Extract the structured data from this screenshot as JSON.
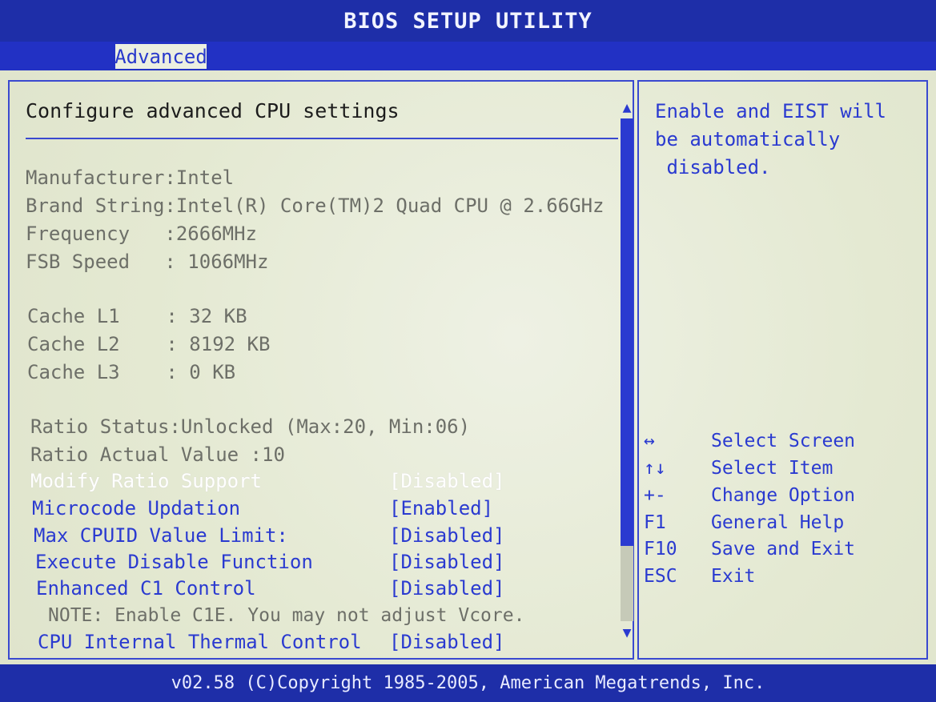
{
  "title": "BIOS SETUP UTILITY",
  "tabs": [
    {
      "label": "Advanced",
      "active": true
    }
  ],
  "section_title": "Configure advanced CPU settings",
  "cpu_info": [
    {
      "label": "Manufacturer",
      "value": ":Intel"
    },
    {
      "label": "Brand String",
      "value": ":Intel(R) Core(TM)2 Quad CPU @ 2.66GHz"
    },
    {
      "label": "Frequency   ",
      "value": ":2666MHz"
    },
    {
      "label": "FSB Speed   ",
      "value": ": 1066MHz"
    }
  ],
  "cache_info": [
    {
      "label": "Cache L1    ",
      "value": ": 32 KB"
    },
    {
      "label": "Cache L2    ",
      "value": ": 8192 KB"
    },
    {
      "label": "Cache L3    ",
      "value": ": 0 KB"
    }
  ],
  "ratio_info": [
    {
      "label": "Ratio Status",
      "value": ":Unlocked (Max:20, Min:06)"
    },
    {
      "label": "Ratio Actual Value ",
      "value": ":10"
    }
  ],
  "options": [
    {
      "label": "Modify Ratio Support",
      "value": "[Disabled]",
      "selected": true
    },
    {
      "label": "Microcode Updation",
      "value": "[Enabled]",
      "selected": false
    },
    {
      "label": "Max CPUID Value Limit:",
      "value": "[Disabled]",
      "selected": false
    },
    {
      "label": "Execute Disable Function",
      "value": "[Disabled]",
      "selected": false
    },
    {
      "label": "Enhanced C1 Control",
      "value": "[Disabled]",
      "selected": false
    }
  ],
  "note": "NOTE: Enable C1E. You may not adjust Vcore.",
  "last_option": {
    "label": "CPU Internal Thermal Control",
    "value": "[Disabled]"
  },
  "help_text": [
    "Enable and EIST will",
    "be automatically",
    " disabled."
  ],
  "key_help": [
    {
      "key": "↔",
      "action": "Select Screen"
    },
    {
      "key": "↑↓",
      "action": "Select Item"
    },
    {
      "key": "+-",
      "action": "Change Option"
    },
    {
      "key": "F1",
      "action": "General Help"
    },
    {
      "key": "F10",
      "action": "Save and Exit"
    },
    {
      "key": "ESC",
      "action": "Exit"
    }
  ],
  "footer": "v02.58 (C)Copyright 1985-2005, American Megatrends, Inc.",
  "icons": {
    "scroll_up": "▲",
    "scroll_down": "▼"
  },
  "colors": {
    "bios_blue": "#1e2ea8",
    "text_blue": "#2a3ad0",
    "panel_bg": "#e6ebd8"
  }
}
